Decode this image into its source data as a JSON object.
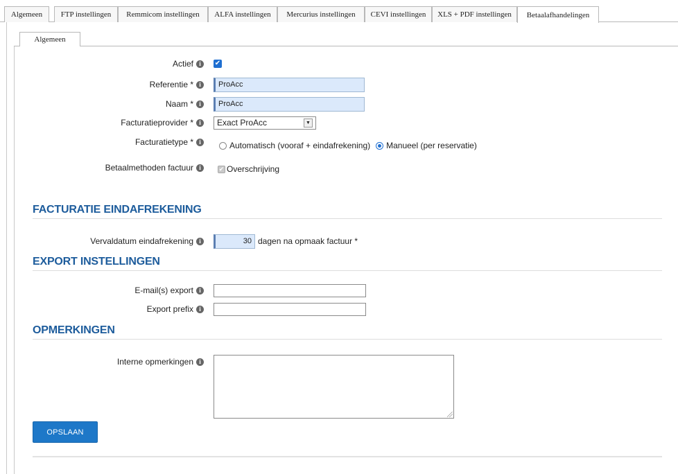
{
  "top_tabs": [
    {
      "label": "Algemeen"
    },
    {
      "label": "FTP instellingen"
    },
    {
      "label": "Remmicom instellingen"
    },
    {
      "label": "ALFA instellingen"
    },
    {
      "label": "Mercurius instellingen"
    },
    {
      "label": "CEVI instellingen"
    },
    {
      "label": "XLS + PDF instellingen"
    },
    {
      "label": "Betaalafhandelingen",
      "active": true
    }
  ],
  "sub_tabs": [
    {
      "label": "Algemeen",
      "active": true
    }
  ],
  "form": {
    "actief": {
      "label": "Actief",
      "checked": true
    },
    "referentie": {
      "label": "Referentie *",
      "value": "ProAcc"
    },
    "naam": {
      "label": "Naam *",
      "value": "ProAcc"
    },
    "facturatieprovider": {
      "label": "Facturatieprovider *",
      "value": "Exact ProAcc"
    },
    "facturatietype": {
      "label": "Facturatietype *",
      "options": [
        "Automatisch (vooraf + eindafrekening)",
        "Manueel (per reservatie)"
      ],
      "selected": "Manueel (per reservatie)"
    },
    "betaalmethoden": {
      "label": "Betaalmethoden factuur",
      "option": "Overschrijving",
      "checked": true,
      "disabled": true
    }
  },
  "sections": {
    "eindafrekening": {
      "title": "FACTURATIE EINDAFREKENING",
      "vervaldatum": {
        "label": "Vervaldatum eindafrekening",
        "value": "30",
        "suffix": "dagen na opmaak factuur *"
      }
    },
    "export": {
      "title": "EXPORT INSTELLINGEN",
      "email": {
        "label": "E-mail(s) export",
        "value": ""
      },
      "prefix": {
        "label": "Export prefix",
        "value": ""
      }
    },
    "opmerkingen": {
      "title": "OPMERKINGEN",
      "interne": {
        "label": "Interne opmerkingen",
        "value": ""
      }
    }
  },
  "save_button": "OPSLAAN",
  "icons": {
    "info": "info-icon",
    "check": "check-icon",
    "dropdown": "chevron-down-icon"
  },
  "colors": {
    "accent": "#1d5c9c",
    "button": "#1e78c8",
    "input_bg": "#dbe9fb"
  }
}
